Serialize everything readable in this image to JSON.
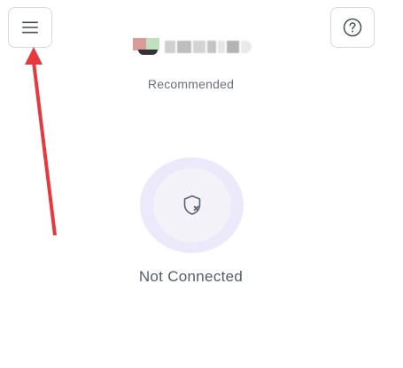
{
  "header": {
    "menu_icon": "hamburger-menu-icon",
    "help_icon": "question-circle-icon"
  },
  "location": {
    "flag_icon": "country-flag-icon",
    "subtitle": "Recommended"
  },
  "connection": {
    "icon": "shield-off-icon",
    "status": "Not Connected"
  },
  "annotation": {
    "icon": "red-arrow-icon",
    "color": "#e8383d"
  },
  "colors": {
    "ring_outer": "#ebe9fa",
    "ring_inner": "#f3f2f8",
    "status_text": "#555b66"
  }
}
